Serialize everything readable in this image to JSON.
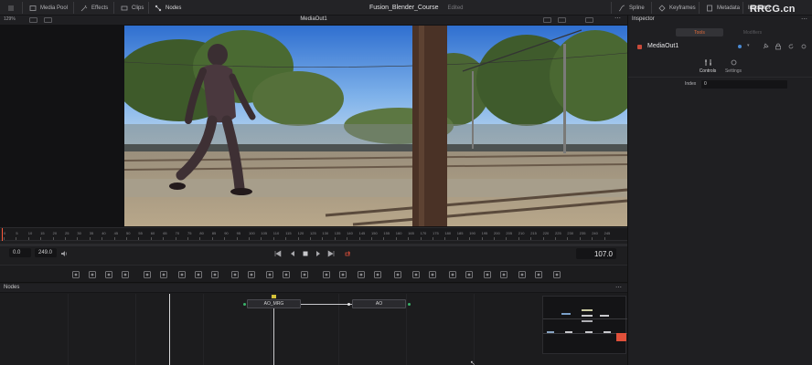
{
  "topbar": {
    "media_pool": "Media Pool",
    "effects": "Effects",
    "clips": "Clips",
    "nodes": "Nodes",
    "project_title": "Fusion_Blender_Course",
    "project_state": "Edited",
    "spline": "Spline",
    "keyframes": "Keyframes",
    "metadata": "Metadata",
    "inspector": "Inspector"
  },
  "viewer": {
    "zoom": "129%",
    "title": "MediaOut1"
  },
  "ruler": {
    "labels": [
      "0",
      "5",
      "10",
      "15",
      "20",
      "25",
      "30",
      "35",
      "40",
      "45",
      "50",
      "55",
      "60",
      "65",
      "70",
      "75",
      "80",
      "85",
      "90",
      "95",
      "100",
      "105",
      "110",
      "115",
      "120",
      "125",
      "130",
      "135",
      "140",
      "145",
      "150",
      "155",
      "160",
      "165",
      "170",
      "175",
      "180",
      "185",
      "190",
      "195",
      "200",
      "205",
      "210",
      "215",
      "220",
      "225",
      "230",
      "235",
      "240",
      "245"
    ]
  },
  "transport": {
    "start": "0.0",
    "end": "249.0",
    "current_frame": "107.0"
  },
  "nodes_panel": {
    "title": "Nodes",
    "node_merge": "AO_MRG",
    "node_ao": "AO"
  },
  "inspector": {
    "title": "Inspector",
    "tab_tools": "Tools",
    "tab_modifiers": "Modifiers",
    "tool_name": "MediaOut1",
    "subtab_controls": "Controls",
    "subtab_settings": "Settings",
    "index_label": "Index",
    "index_value": "0"
  },
  "watermark": "RRCG.cn",
  "colors": {
    "accent": "#e06b3a",
    "tool_dot": "#c94a3a",
    "playhead": "#ff5a3c",
    "tab_active": "#3a3a3e"
  }
}
